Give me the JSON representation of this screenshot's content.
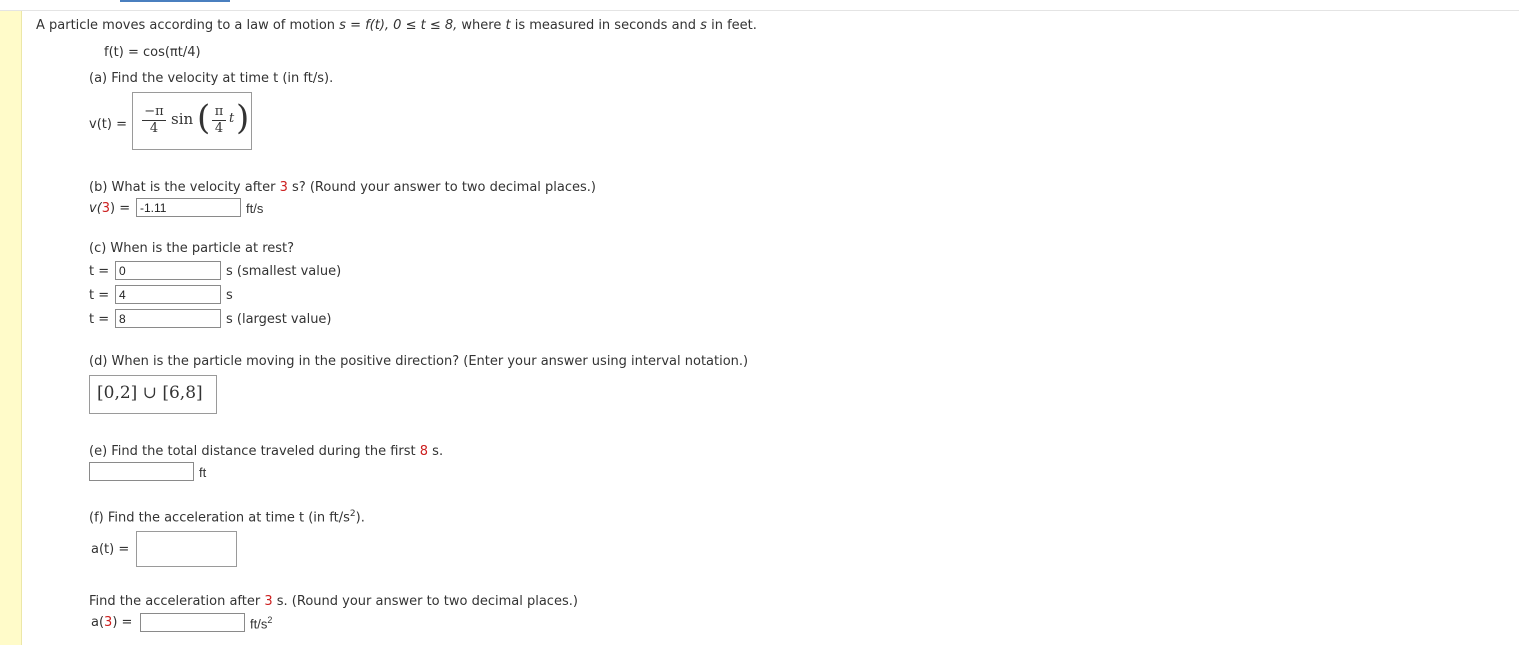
{
  "intro": {
    "text_a": "A particle moves according to a law of motion ",
    "s_eq": "s = f(t), 0 ≤ t ≤ 8,",
    "text_b": " where ",
    "t": "t",
    "text_c": " is measured in seconds and ",
    "s": "s",
    "text_d": " in feet."
  },
  "function_def": "f(t) = cos(πt/4)",
  "part_a": {
    "question": "(a) Find the velocity at time t (in ft/s).",
    "label": "v(t) =",
    "answer": {
      "num1": "−π",
      "den1": "4",
      "sin": "sin",
      "num2": "π",
      "den2": "4",
      "var": "t"
    }
  },
  "part_b": {
    "question_pre": "(b) What is the velocity after ",
    "highlight": "3",
    "question_post": " s? (Round your answer to two decimal places.)",
    "label_pre": "v(",
    "label_num": "3",
    "label_post": ") =",
    "value": "-1.11",
    "unit": "ft/s"
  },
  "part_c": {
    "question": "(c) When is the particle at rest?",
    "rows": [
      {
        "label": "t =",
        "value": "0",
        "suffix": "s (smallest value)"
      },
      {
        "label": "t =",
        "value": "4",
        "suffix": "s"
      },
      {
        "label": "t =",
        "value": "8",
        "suffix": "s (largest value)"
      }
    ]
  },
  "part_d": {
    "question": "(d) When is the particle moving in the positive direction? (Enter your answer using interval notation.)",
    "answer": "[0,2] ∪ [6,8]"
  },
  "part_e": {
    "question_pre": "(e) Find the total distance traveled during the first ",
    "highlight": "8",
    "question_post": " s.",
    "value": "",
    "unit": "ft"
  },
  "part_f": {
    "question_pre": "(f) Find the acceleration at time t (in ft/s",
    "exp": "2",
    "question_post": ").",
    "label": "a(t) =",
    "value": ""
  },
  "part_g": {
    "question_pre": "Find the acceleration after ",
    "highlight": "3",
    "question_post": " s. (Round your answer to two decimal places.)",
    "label_pre": "a(",
    "label_num": "3",
    "label_post": ") =",
    "value": "",
    "unit": "ft/s",
    "unit_exp": "2"
  }
}
